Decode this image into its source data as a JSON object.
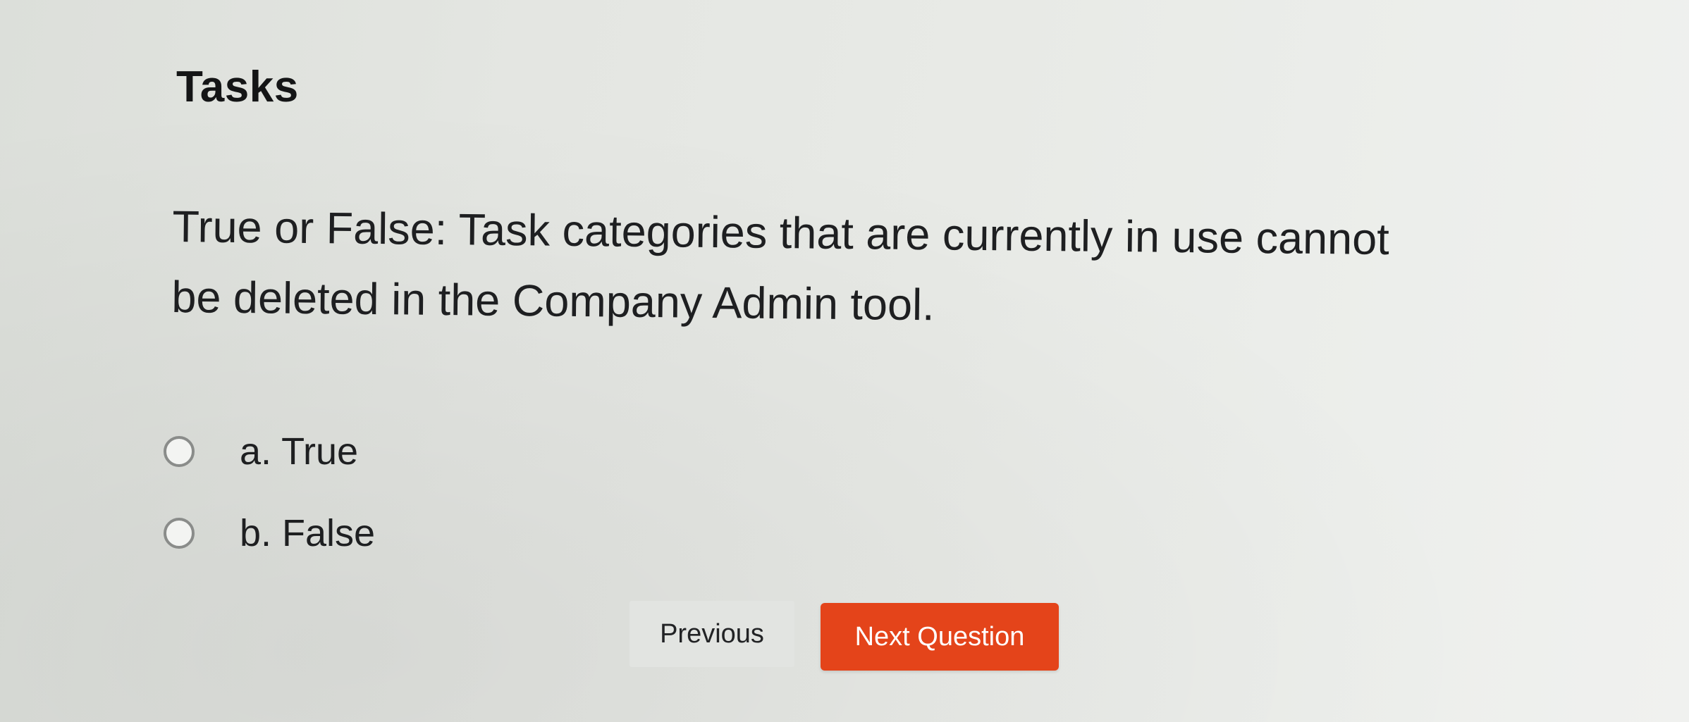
{
  "page": {
    "title": "Tasks"
  },
  "question": {
    "text": "True or False: Task categories that are currently in use cannot be deleted in the Company Admin tool."
  },
  "options": [
    {
      "label": "a. True",
      "selected": false
    },
    {
      "label": "b. False",
      "selected": false
    }
  ],
  "navigation": {
    "previous_label": "Previous",
    "next_label": "Next Question"
  },
  "colors": {
    "primary_button": "#e4441a",
    "secondary_button": "#e2e4e1",
    "radio_border": "#8a8c8a"
  }
}
